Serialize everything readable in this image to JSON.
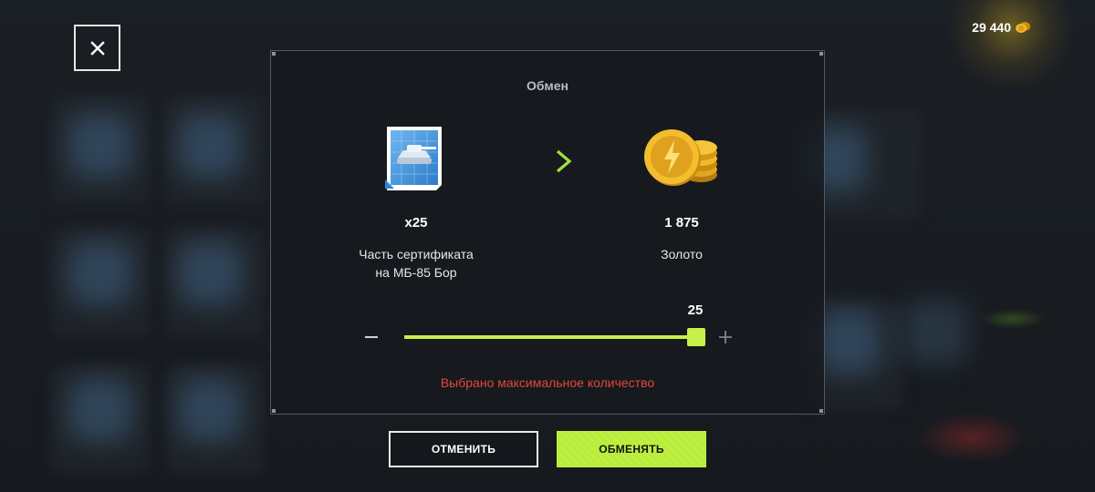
{
  "header": {
    "balance": "29 440",
    "balance_icon": "gold-coin-icon",
    "close_icon": "close-icon"
  },
  "dialog": {
    "title": "Обмен",
    "give": {
      "icon": "blueprint-certificate-icon",
      "quantity": "x25",
      "label_line1": "Часть сертификата",
      "label_line2": "на МБ-85 Бор"
    },
    "arrow_icon": "arrow-right-icon",
    "get": {
      "icon": "gold-coins-stack-icon",
      "quantity": "1 875",
      "label": "Золото"
    },
    "slider": {
      "value": "25",
      "min": 0,
      "max": 25,
      "current": 25,
      "fill_color": "#c8f04a"
    },
    "warning": "Выбрано максимальное количество",
    "warning_color": "#e2463f"
  },
  "buttons": {
    "cancel": "ОТМЕНИТЬ",
    "exchange": "ОБМЕНЯТЬ",
    "accent": "#b8ee3a"
  }
}
